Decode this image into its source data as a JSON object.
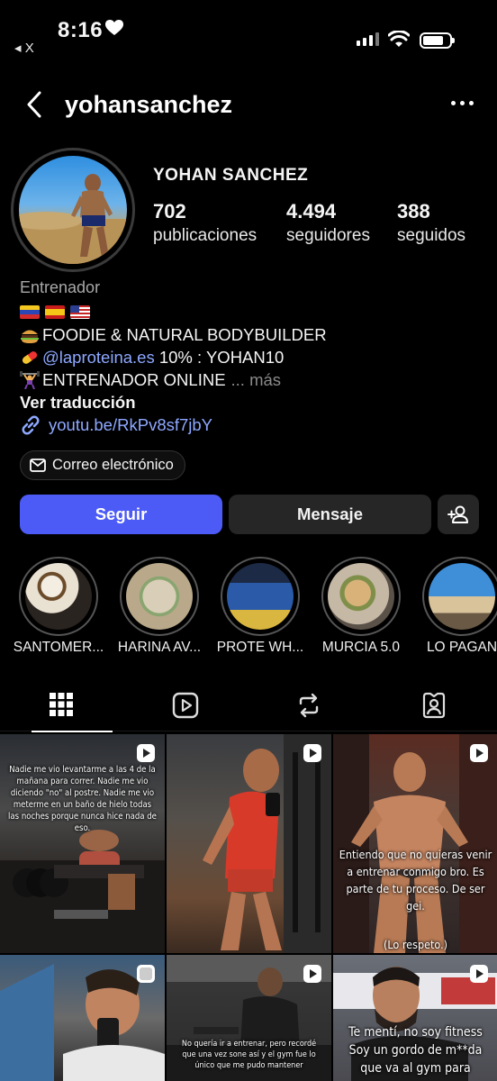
{
  "status_bar": {
    "time": "8:16",
    "back_label": "◂ X"
  },
  "header": {
    "username": "yohansanchez"
  },
  "profile": {
    "display_name": "YOHAN SANCHEZ",
    "stats": [
      {
        "value": "702",
        "label": "publicaciones"
      },
      {
        "value": "4.494",
        "label": "seguidores"
      },
      {
        "value": "388",
        "label": "seguidos"
      }
    ],
    "category": "Entrenador",
    "bio_line_1": "FOODIE & NATURAL BODYBUILDER",
    "bio_mention": "@laproteina.es",
    "bio_code": " 10% : YOHAN10",
    "bio_line_3": "ENTRENADOR ONLINE",
    "more": "... más",
    "translate": "Ver traducción",
    "link": "youtu.be/RkPv8sf7jbY",
    "email_label": "Correo electrónico"
  },
  "actions": {
    "follow": "Seguir",
    "message": "Mensaje"
  },
  "highlights": [
    {
      "label": "SANTOMER..."
    },
    {
      "label": "HARINA AV..."
    },
    {
      "label": "PROTE WH..."
    },
    {
      "label": "MURCIA 5.0"
    },
    {
      "label": "LO PAGAN"
    }
  ],
  "posts": [
    {
      "caption": "Nadie me vio levantarme a las 4 de la mañana para correr. Nadie me vio diciendo \"no\" al postre. Nadie me vio meterme en un baño de hielo todas las noches porque nunca hice nada de eso."
    },
    {
      "caption": ""
    },
    {
      "caption": "Entiendo que no quieras venir a entrenar conmigo bro. Es parte de tu proceso. De ser gei.",
      "caption_2": "(Lo respeto.)"
    },
    {
      "caption": ""
    },
    {
      "caption": "No quería ir a entrenar, pero recordé que una vez sone así y el gym fue lo único que me pudo mantener"
    },
    {
      "caption": "Te mentí, no soy fitness Soy un gordo de m**da que va al gym para"
    }
  ],
  "colors": {
    "follow": "#4c5bf5",
    "link": "#8ea8ff",
    "button_dark": "#262626"
  }
}
